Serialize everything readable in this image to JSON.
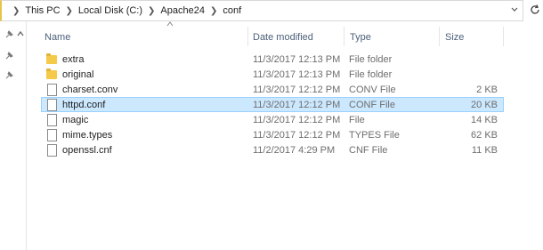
{
  "breadcrumb": [
    "This PC",
    "Local Disk (C:)",
    "Apache24",
    "conf"
  ],
  "columns": {
    "name": "Name",
    "date": "Date modified",
    "type": "Type",
    "size": "Size"
  },
  "files": [
    {
      "name": "extra",
      "date": "11/3/2017 12:13 PM",
      "type": "File folder",
      "size": "",
      "icon": "folder-icon",
      "selected": false
    },
    {
      "name": "original",
      "date": "11/3/2017 12:13 PM",
      "type": "File folder",
      "size": "",
      "icon": "folder-icon",
      "selected": false
    },
    {
      "name": "charset.conv",
      "date": "11/3/2017 12:12 PM",
      "type": "CONV File",
      "size": "2 KB",
      "icon": "file-icon",
      "selected": false
    },
    {
      "name": "httpd.conf",
      "date": "11/3/2017 12:12 PM",
      "type": "CONF File",
      "size": "20 KB",
      "icon": "file-icon",
      "selected": true
    },
    {
      "name": "magic",
      "date": "11/3/2017 12:12 PM",
      "type": "File",
      "size": "14 KB",
      "icon": "file-icon",
      "selected": false
    },
    {
      "name": "mime.types",
      "date": "11/3/2017 12:12 PM",
      "type": "TYPES File",
      "size": "62 KB",
      "icon": "file-icon",
      "selected": false
    },
    {
      "name": "openssl.cnf",
      "date": "11/2/2017 4:29 PM",
      "type": "CNF File",
      "size": "11 KB",
      "icon": "file-icon",
      "selected": false
    }
  ],
  "colors": {
    "selected_bg": "#cce8ff",
    "selected_border": "#99d1ff",
    "folder": "#f5c94a",
    "header_text": "#4c607a"
  }
}
